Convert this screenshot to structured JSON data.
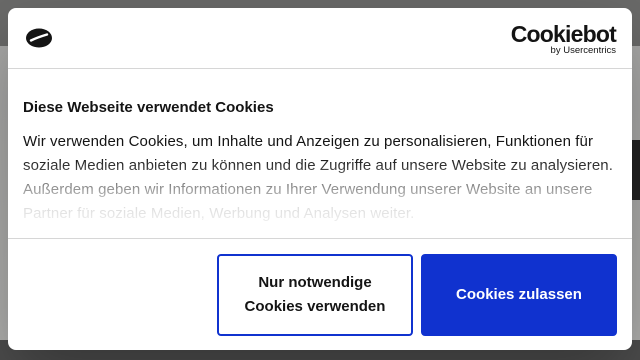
{
  "dialog": {
    "brand": {
      "name": "Cookiebot",
      "sub": "by Usercentrics"
    },
    "title": "Diese Webseite verwendet Cookies",
    "body": "Wir verwenden Cookies, um Inhalte und Anzeigen zu personalisieren, Funktionen für soziale Medien anbieten zu können und die Zugriffe auf unsere Website zu analysieren. Außerdem geben wir Informationen zu Ihrer Verwendung unserer Website an unsere Partner für soziale Medien, Werbung und Analysen weiter.",
    "buttons": {
      "necessary": "Nur notwendige Cookies verwenden",
      "allow": "Cookies zulassen"
    }
  },
  "colors": {
    "accent": "#1032cf",
    "text": "#141414",
    "divider": "#d6d6d6"
  },
  "icons": {
    "cookie": "cookie-icon"
  }
}
